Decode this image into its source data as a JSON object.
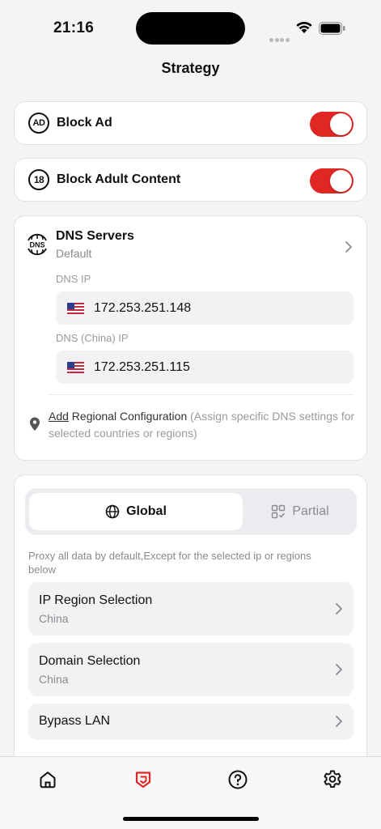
{
  "status_bar": {
    "time": "21:16"
  },
  "header": {
    "title": "Strategy"
  },
  "block_ad": {
    "icon_text": "AD",
    "label": "Block Ad",
    "enabled": true
  },
  "block_adult": {
    "icon_text": "18",
    "label": "Block Adult Content",
    "enabled": true
  },
  "dns": {
    "title": "DNS Servers",
    "subtitle": "Default",
    "dns_ip_label": "DNS IP",
    "dns_ip": "172.253.251.148",
    "dns_china_label": "DNS (China) IP",
    "dns_china_ip": "172.253.251.115",
    "region_add": "Add",
    "region_config": " Regional Configuration",
    "region_note": " (Assign specific DNS settings for selected countries or regions)"
  },
  "proxy": {
    "mode_global": "Global",
    "mode_partial": "Partial",
    "description": "Proxy all data by default,Except for the selected ip or regions below",
    "rows": [
      {
        "title": "IP Region Selection",
        "subtitle": "China"
      },
      {
        "title": "Domain Selection",
        "subtitle": "China"
      },
      {
        "title": "Bypass LAN"
      }
    ]
  },
  "tabbar": {
    "tabs": [
      "home-icon",
      "shield-icon",
      "help-icon",
      "settings-icon"
    ],
    "active": "shield-icon",
    "active_color": "#e02724"
  },
  "colors": {
    "accent": "#e02724"
  }
}
